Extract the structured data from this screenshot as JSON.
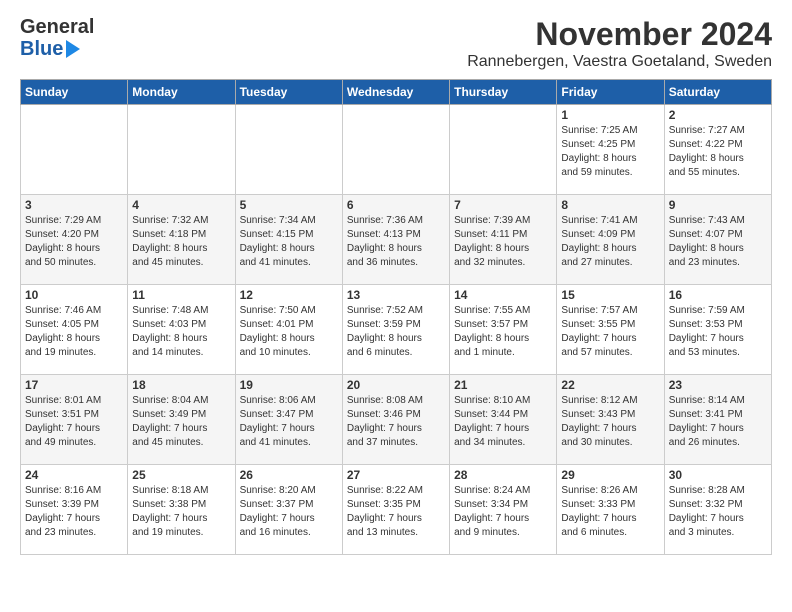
{
  "header": {
    "logo_line1": "General",
    "logo_line2": "Blue",
    "month_year": "November 2024",
    "location": "Rannebergen, Vaestra Goetaland, Sweden"
  },
  "weekdays": [
    "Sunday",
    "Monday",
    "Tuesday",
    "Wednesday",
    "Thursday",
    "Friday",
    "Saturday"
  ],
  "weeks": [
    [
      {
        "day": "",
        "info": ""
      },
      {
        "day": "",
        "info": ""
      },
      {
        "day": "",
        "info": ""
      },
      {
        "day": "",
        "info": ""
      },
      {
        "day": "",
        "info": ""
      },
      {
        "day": "1",
        "info": "Sunrise: 7:25 AM\nSunset: 4:25 PM\nDaylight: 8 hours\nand 59 minutes."
      },
      {
        "day": "2",
        "info": "Sunrise: 7:27 AM\nSunset: 4:22 PM\nDaylight: 8 hours\nand 55 minutes."
      }
    ],
    [
      {
        "day": "3",
        "info": "Sunrise: 7:29 AM\nSunset: 4:20 PM\nDaylight: 8 hours\nand 50 minutes."
      },
      {
        "day": "4",
        "info": "Sunrise: 7:32 AM\nSunset: 4:18 PM\nDaylight: 8 hours\nand 45 minutes."
      },
      {
        "day": "5",
        "info": "Sunrise: 7:34 AM\nSunset: 4:15 PM\nDaylight: 8 hours\nand 41 minutes."
      },
      {
        "day": "6",
        "info": "Sunrise: 7:36 AM\nSunset: 4:13 PM\nDaylight: 8 hours\nand 36 minutes."
      },
      {
        "day": "7",
        "info": "Sunrise: 7:39 AM\nSunset: 4:11 PM\nDaylight: 8 hours\nand 32 minutes."
      },
      {
        "day": "8",
        "info": "Sunrise: 7:41 AM\nSunset: 4:09 PM\nDaylight: 8 hours\nand 27 minutes."
      },
      {
        "day": "9",
        "info": "Sunrise: 7:43 AM\nSunset: 4:07 PM\nDaylight: 8 hours\nand 23 minutes."
      }
    ],
    [
      {
        "day": "10",
        "info": "Sunrise: 7:46 AM\nSunset: 4:05 PM\nDaylight: 8 hours\nand 19 minutes."
      },
      {
        "day": "11",
        "info": "Sunrise: 7:48 AM\nSunset: 4:03 PM\nDaylight: 8 hours\nand 14 minutes."
      },
      {
        "day": "12",
        "info": "Sunrise: 7:50 AM\nSunset: 4:01 PM\nDaylight: 8 hours\nand 10 minutes."
      },
      {
        "day": "13",
        "info": "Sunrise: 7:52 AM\nSunset: 3:59 PM\nDaylight: 8 hours\nand 6 minutes."
      },
      {
        "day": "14",
        "info": "Sunrise: 7:55 AM\nSunset: 3:57 PM\nDaylight: 8 hours\nand 1 minute."
      },
      {
        "day": "15",
        "info": "Sunrise: 7:57 AM\nSunset: 3:55 PM\nDaylight: 7 hours\nand 57 minutes."
      },
      {
        "day": "16",
        "info": "Sunrise: 7:59 AM\nSunset: 3:53 PM\nDaylight: 7 hours\nand 53 minutes."
      }
    ],
    [
      {
        "day": "17",
        "info": "Sunrise: 8:01 AM\nSunset: 3:51 PM\nDaylight: 7 hours\nand 49 minutes."
      },
      {
        "day": "18",
        "info": "Sunrise: 8:04 AM\nSunset: 3:49 PM\nDaylight: 7 hours\nand 45 minutes."
      },
      {
        "day": "19",
        "info": "Sunrise: 8:06 AM\nSunset: 3:47 PM\nDaylight: 7 hours\nand 41 minutes."
      },
      {
        "day": "20",
        "info": "Sunrise: 8:08 AM\nSunset: 3:46 PM\nDaylight: 7 hours\nand 37 minutes."
      },
      {
        "day": "21",
        "info": "Sunrise: 8:10 AM\nSunset: 3:44 PM\nDaylight: 7 hours\nand 34 minutes."
      },
      {
        "day": "22",
        "info": "Sunrise: 8:12 AM\nSunset: 3:43 PM\nDaylight: 7 hours\nand 30 minutes."
      },
      {
        "day": "23",
        "info": "Sunrise: 8:14 AM\nSunset: 3:41 PM\nDaylight: 7 hours\nand 26 minutes."
      }
    ],
    [
      {
        "day": "24",
        "info": "Sunrise: 8:16 AM\nSunset: 3:39 PM\nDaylight: 7 hours\nand 23 minutes."
      },
      {
        "day": "25",
        "info": "Sunrise: 8:18 AM\nSunset: 3:38 PM\nDaylight: 7 hours\nand 19 minutes."
      },
      {
        "day": "26",
        "info": "Sunrise: 8:20 AM\nSunset: 3:37 PM\nDaylight: 7 hours\nand 16 minutes."
      },
      {
        "day": "27",
        "info": "Sunrise: 8:22 AM\nSunset: 3:35 PM\nDaylight: 7 hours\nand 13 minutes."
      },
      {
        "day": "28",
        "info": "Sunrise: 8:24 AM\nSunset: 3:34 PM\nDaylight: 7 hours\nand 9 minutes."
      },
      {
        "day": "29",
        "info": "Sunrise: 8:26 AM\nSunset: 3:33 PM\nDaylight: 7 hours\nand 6 minutes."
      },
      {
        "day": "30",
        "info": "Sunrise: 8:28 AM\nSunset: 3:32 PM\nDaylight: 7 hours\nand 3 minutes."
      }
    ]
  ]
}
